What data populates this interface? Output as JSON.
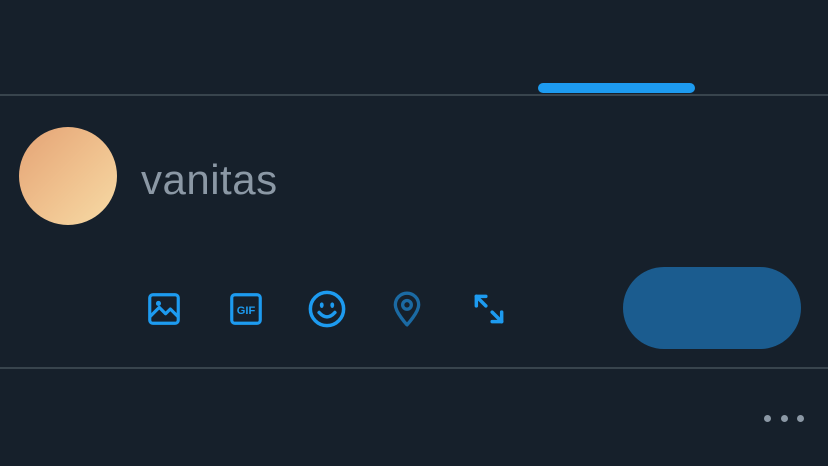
{
  "tabs": {
    "active_indicator": "active-tab-underline"
  },
  "composer": {
    "avatar": "user-avatar",
    "input_value": "vanitas",
    "toolbar": [
      {
        "name": "image-icon",
        "label": ""
      },
      {
        "name": "gif-icon",
        "label": "GIF"
      },
      {
        "name": "emoji-icon",
        "label": ""
      },
      {
        "name": "location-icon",
        "label": ""
      },
      {
        "name": "expand-icon",
        "label": ""
      }
    ],
    "submit_label": ""
  },
  "footer": {
    "more_icon": "more-horizontal-icon"
  },
  "colors": {
    "background": "#16202b",
    "accent": "#1d9bf0",
    "button_disabled": "#1b5c8f",
    "muted_text": "#8b98a5",
    "divider": "#38444d"
  }
}
